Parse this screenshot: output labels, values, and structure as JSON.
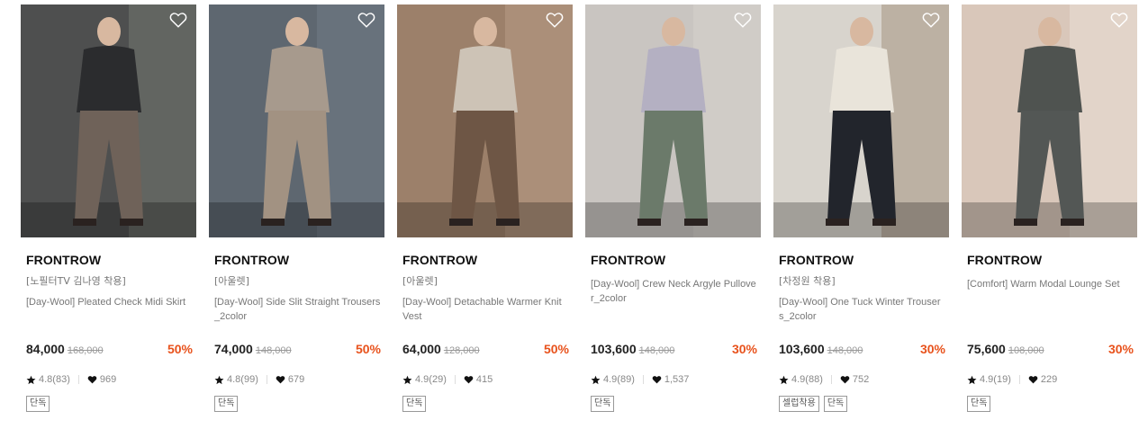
{
  "products": [
    {
      "brand": "FRONTROW",
      "tag": "[노필터TV 김나영 착용]",
      "name": "[Day-Wool] Pleated Check Midi Skirt",
      "price": "84,000",
      "original_price": "168,000",
      "discount": "50%",
      "rating": "4.8(83)",
      "likes": "969",
      "badges": [
        "단독"
      ],
      "photo": {
        "bg": "#4e4f4f",
        "top": "#2b2c2e",
        "bottom": "#6f6259",
        "accent": "#8a8f84"
      }
    },
    {
      "brand": "FRONTROW",
      "tag": "[아울렛]",
      "name": "[Day-Wool] Side Slit Straight Trousers_2color",
      "price": "74,000",
      "original_price": "148,000",
      "discount": "50%",
      "rating": "4.8(99)",
      "likes": "679",
      "badges": [
        "단독"
      ],
      "photo": {
        "bg": "#5e6770",
        "top": "#a79a8d",
        "bottom": "#a29282",
        "accent": "#7c8891"
      }
    },
    {
      "brand": "FRONTROW",
      "tag": "[아울렛]",
      "name": "[Day-Wool] Detachable Warmer Knit Vest",
      "price": "64,000",
      "original_price": "128,000",
      "discount": "50%",
      "rating": "4.9(29)",
      "likes": "415",
      "badges": [
        "단독"
      ],
      "photo": {
        "bg": "#9c806a",
        "top": "#cdc3b6",
        "bottom": "#6e5645",
        "accent": "#c8ad95"
      }
    },
    {
      "brand": "FRONTROW",
      "tag": "",
      "name": "[Day-Wool] Crew Neck Argyle Pullover_2color",
      "price": "103,600",
      "original_price": "148,000",
      "discount": "30%",
      "rating": "4.9(89)",
      "likes": "1,537",
      "badges": [
        "단독"
      ],
      "photo": {
        "bg": "#c9c5c1",
        "top": "#b4b0c2",
        "bottom": "#6b7a6a",
        "accent": "#dcd9d5"
      }
    },
    {
      "brand": "FRONTROW",
      "tag": "[차정원 착용]",
      "name": "[Day-Wool] One Tuck Winter Trousers_2color",
      "price": "103,600",
      "original_price": "148,000",
      "discount": "30%",
      "rating": "4.9(88)",
      "likes": "752",
      "badges": [
        "셀럽착용",
        "단독"
      ],
      "photo": {
        "bg": "#d8d4cd",
        "top": "#e9e4da",
        "bottom": "#22252c",
        "accent": "#8a6f55"
      }
    },
    {
      "brand": "FRONTROW",
      "tag": "",
      "name": "[Comfort] Warm Modal Lounge Set",
      "price": "75,600",
      "original_price": "108,000",
      "discount": "30%",
      "rating": "4.9(19)",
      "likes": "229",
      "badges": [
        "단독"
      ],
      "photo": {
        "bg": "#d9c7ba",
        "top": "#4f5350",
        "bottom": "#535755",
        "accent": "#f3ede6"
      }
    }
  ],
  "colors": {
    "discount": "#e8521c",
    "text": "#222222",
    "muted": "#777777"
  },
  "icons": {
    "wishlist": "heart-outline-icon",
    "rating": "star-icon",
    "likes": "heart-filled-icon"
  }
}
